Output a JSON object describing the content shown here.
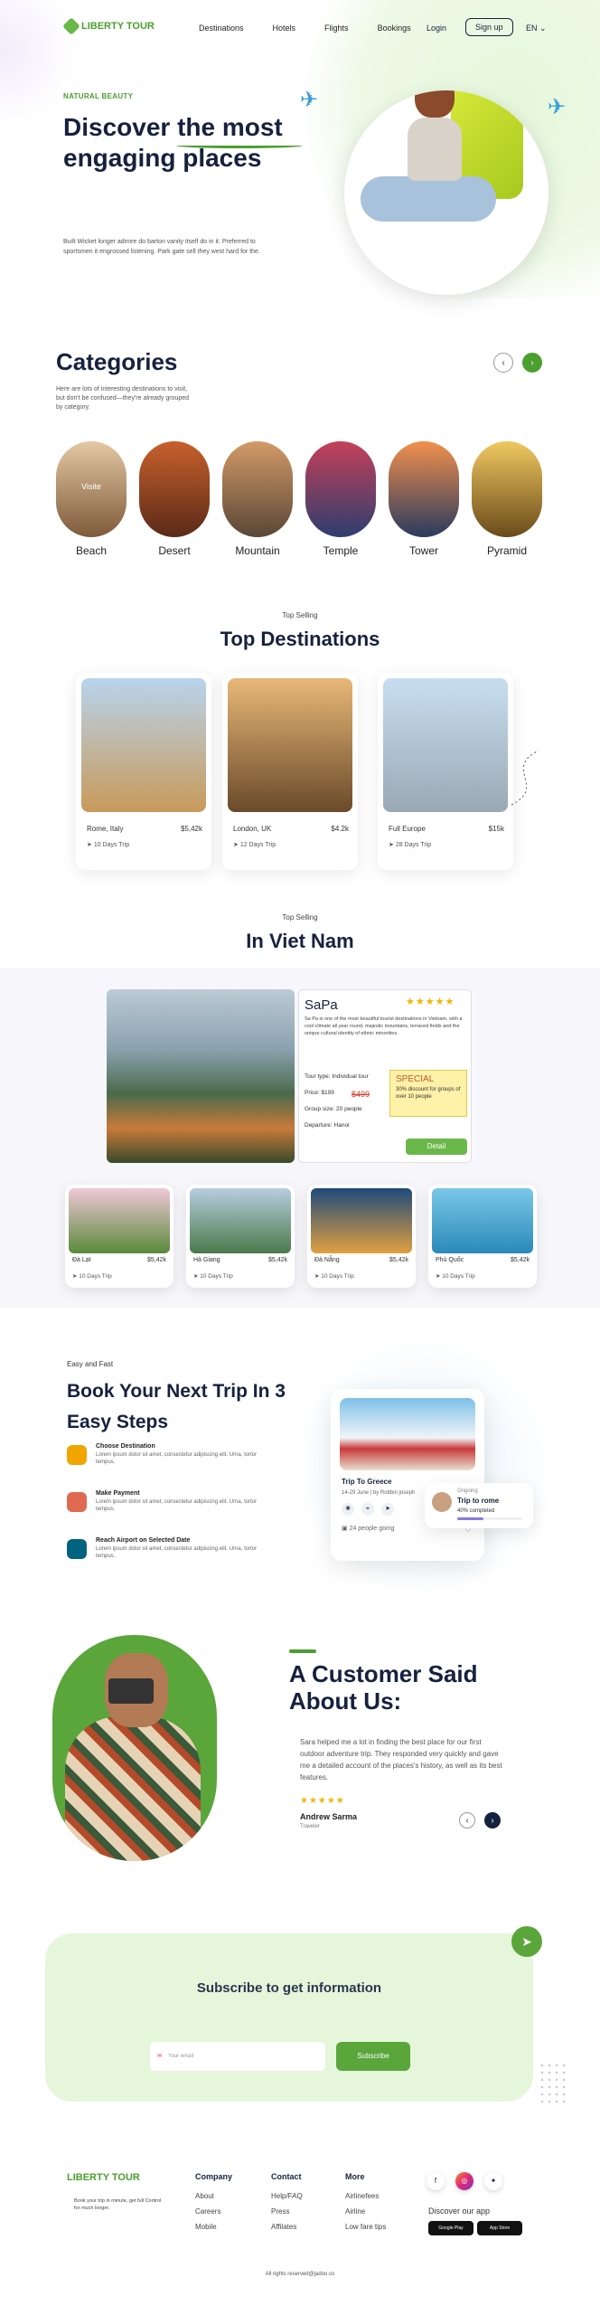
{
  "nav": {
    "logo": "LIBERTY TOUR",
    "links": [
      "Destinations",
      "Hotels",
      "Flights",
      "Bookings"
    ],
    "login": "Login",
    "signup": "Sign up",
    "lang": "EN ⌄"
  },
  "hero": {
    "tag": "NATURAL BEAUTY",
    "title": "Discover the most engaging places",
    "desc": "Built Wicket longer admire do barton vanity itself do in it. Preferred to sportsmen it engrossed listening. Park gate sell they west hard for the."
  },
  "categories": {
    "title": "Categories",
    "desc": "Here are lots of interesting destinations to visit, but don't be confused—they're already grouped by category.",
    "visit_label": "Visite",
    "items": [
      {
        "label": "Beach",
        "colors": [
          "#e4c8a4",
          "#7e5a3a"
        ]
      },
      {
        "label": "Desert",
        "colors": [
          "#c8602c",
          "#5a2a18"
        ]
      },
      {
        "label": "Mountain",
        "colors": [
          "#d39a68",
          "#5a4636"
        ]
      },
      {
        "label": "Temple",
        "colors": [
          "#c4405a",
          "#2e3e6e"
        ]
      },
      {
        "label": "Tower",
        "colors": [
          "#f2904c",
          "#2a3a5e"
        ]
      },
      {
        "label": "Pyramid",
        "colors": [
          "#f0c860",
          "#6a4a1a"
        ]
      }
    ]
  },
  "top": {
    "tag": "Top Selling",
    "title": "Top Destinations",
    "cards": [
      {
        "name": "Rome, Italy",
        "price": "$5,42k",
        "trip": "10 Days Trip",
        "colors": [
          "#b8d4ee",
          "#c89a5a"
        ]
      },
      {
        "name": "London, UK",
        "price": "$4.2k",
        "trip": "12 Days Trip",
        "colors": [
          "#e8b878",
          "#6a4a2a"
        ]
      },
      {
        "name": "Full Europe",
        "price": "$15k",
        "trip": "28 Days Trip",
        "colors": [
          "#c8def0",
          "#9aa8b4"
        ]
      }
    ]
  },
  "vn": {
    "tag": "Top Selling",
    "title": "In Viet Nam",
    "feature": {
      "title": "SaPa",
      "stars": "★★★★★",
      "desc": "Sa Pa is one of the most beautiful tourist destinations in Vietnam, with a cool climate all year round, majestic mountains, terraced fields and the unique cultural identity of ethnic minorities.",
      "rows": [
        "Tour type: Individual tour",
        "Price: $199",
        "Group size: 20 people",
        "Departure: Hanoi"
      ],
      "old_price": "$499",
      "special_title": "SPECIAL",
      "special_desc": "30% discount for groups of over 10 people",
      "detail": "Detail"
    },
    "cards": [
      {
        "name": "Đà Lạt",
        "price": "$5,42k",
        "trip": "10 Days Trip",
        "colors": [
          "#f0c8d8",
          "#5a8a3a"
        ]
      },
      {
        "name": "Hà Giang",
        "price": "$5,42k",
        "trip": "10 Days Trip",
        "colors": [
          "#b8cde0",
          "#4a7a4a"
        ]
      },
      {
        "name": "Đà Nẵng",
        "price": "$5,42k",
        "trip": "10 Days Trip",
        "colors": [
          "#1e4a7a",
          "#e0a040"
        ]
      },
      {
        "name": "Phú Quốc",
        "price": "$5,42k",
        "trip": "10 Days Trip",
        "colors": [
          "#7ac8e8",
          "#2a8ab8"
        ]
      }
    ]
  },
  "steps": {
    "tag": "Easy and Fast",
    "title": "Book Your Next Trip In 3 Easy Steps",
    "items": [
      {
        "title": "Choose Destination",
        "desc": "Lorem ipsum dolor sit amet, consectetur adipiscing elit. Urna, tortor tempus.",
        "color": "#f1a501"
      },
      {
        "title": "Make Payment",
        "desc": "Lorem ipsum dolor sit amet, consectetur adipiscing elit. Urna, tortor tempus.",
        "color": "#df6951"
      },
      {
        "title": "Reach Airport on Selected Date",
        "desc": "Lorem ipsum dolor sit amet, consectetur adipiscing elit. Urna, tortor tempus.",
        "color": "#006380"
      }
    ],
    "card": {
      "name": "Trip To Greece",
      "meta": "14-29 June | by Robbin joseph",
      "going": "24 people going",
      "ongoing_label": "Ongoing",
      "ongoing_title": "Trip to rome",
      "ongoing_progress": "40% completed",
      "progress": 0.4
    }
  },
  "customer": {
    "title": "A Customer Said About Us:",
    "quote": "Sara helped me a lot in finding the best place for our first outdoor adventure trip. They responded very quickly and gave me a detailed account of the places's history, as well as its best features.",
    "stars": "★★★★★",
    "name": "Andrew Sarma",
    "role": "Traveler"
  },
  "subscribe": {
    "title": "Subscribe to get information",
    "placeholder": "Your email",
    "button": "Subscribe"
  },
  "footer": {
    "logo": "LIBERTY TOUR",
    "desc": "Book your trip in minute, get full Control for much longer.",
    "cols": [
      {
        "title": "Company",
        "items": [
          "About",
          "Careers",
          "Mobile"
        ]
      },
      {
        "title": "Contact",
        "items": [
          "Help/FAQ",
          "Press",
          "Affilates"
        ]
      },
      {
        "title": "More",
        "items": [
          "Airlinefees",
          "Airline",
          "Low fare tips"
        ]
      }
    ],
    "discover": "Discover our app",
    "google_play": "Google Play",
    "app_store": "App Store",
    "copyright": "All rights reserved@jadoo.co"
  }
}
